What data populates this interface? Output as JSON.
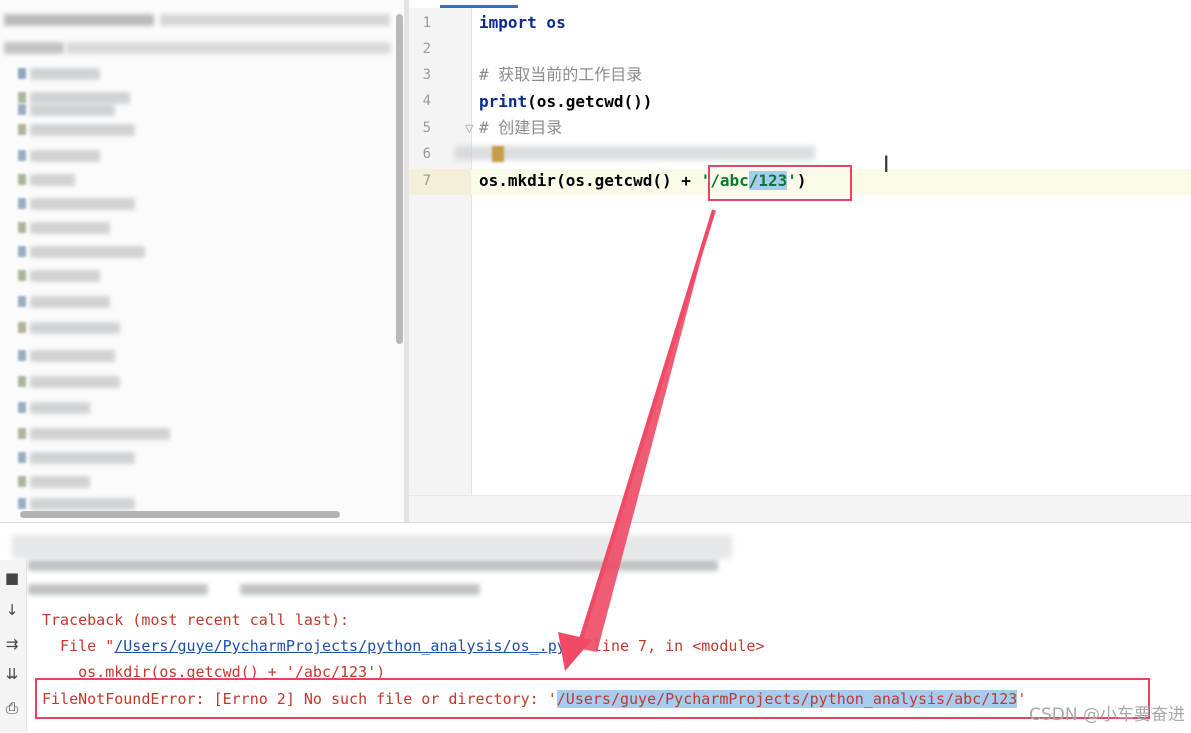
{
  "editor": {
    "line_numbers": [
      "1",
      "2",
      "3",
      "4",
      "5",
      "6",
      "7"
    ],
    "lines": {
      "l1_kw": "import",
      "l1_rest": " os",
      "l3_comment": "# 获取当前的工作目录",
      "l4_kw": "print",
      "l4_rest": "(os.getcwd())",
      "l5_comment": "# 创建目录",
      "l7_pre": "os.mkdir(os.getcwd() + ",
      "l7_str_a": "'/abc",
      "l7_str_sel": "/123",
      "l7_str_b": "'",
      "l7_post": ")"
    },
    "caret_icon": "text-cursor-icon"
  },
  "console": {
    "traceback_header": "Traceback (most recent call last):",
    "file_prefix": "  File \"",
    "file_link": "/Users/guye/PycharmProjects/python_analysis/os_.py",
    "file_suffix": "\", line 7, in <module>",
    "code_line": "    os.mkdir(os.getcwd() + '/abc/123')",
    "error_prefix": "FileNotFoundError: [Errno 2] No such file or directory: '",
    "error_path": "/Users/guye/PycharmProjects/python_analysis/abc/123",
    "error_suffix": "'"
  },
  "toolbar_icons": [
    "stop-icon",
    "scroll-down-icon",
    "soft-wrap-icon",
    "scroll-to-end-icon",
    "print-icon"
  ],
  "watermark": "CSDN @小车要奋进",
  "colors": {
    "annotation_red": "#e8445f",
    "error_text": "#c0392b",
    "keyword": "#0b2a8f",
    "string": "#0a7a30",
    "selection": "#a6cdf0"
  }
}
